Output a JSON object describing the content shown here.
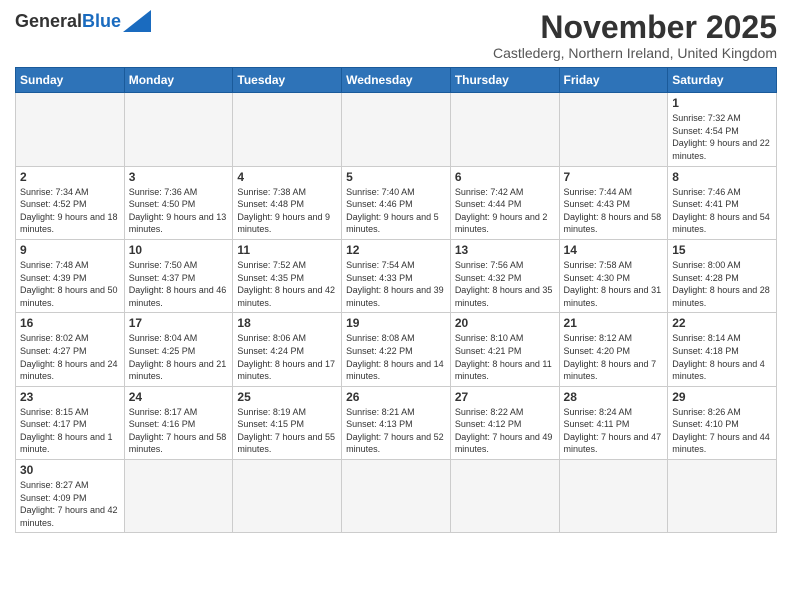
{
  "header": {
    "logo_general": "General",
    "logo_blue": "Blue",
    "title": "November 2025",
    "subtitle": "Castlederg, Northern Ireland, United Kingdom"
  },
  "calendar": {
    "days_of_week": [
      "Sunday",
      "Monday",
      "Tuesday",
      "Wednesday",
      "Thursday",
      "Friday",
      "Saturday"
    ],
    "weeks": [
      [
        {
          "day": null,
          "info": ""
        },
        {
          "day": null,
          "info": ""
        },
        {
          "day": null,
          "info": ""
        },
        {
          "day": null,
          "info": ""
        },
        {
          "day": null,
          "info": ""
        },
        {
          "day": null,
          "info": ""
        },
        {
          "day": "1",
          "info": "Sunrise: 7:32 AM\nSunset: 4:54 PM\nDaylight: 9 hours and 22 minutes."
        }
      ],
      [
        {
          "day": "2",
          "info": "Sunrise: 7:34 AM\nSunset: 4:52 PM\nDaylight: 9 hours and 18 minutes."
        },
        {
          "day": "3",
          "info": "Sunrise: 7:36 AM\nSunset: 4:50 PM\nDaylight: 9 hours and 13 minutes."
        },
        {
          "day": "4",
          "info": "Sunrise: 7:38 AM\nSunset: 4:48 PM\nDaylight: 9 hours and 9 minutes."
        },
        {
          "day": "5",
          "info": "Sunrise: 7:40 AM\nSunset: 4:46 PM\nDaylight: 9 hours and 5 minutes."
        },
        {
          "day": "6",
          "info": "Sunrise: 7:42 AM\nSunset: 4:44 PM\nDaylight: 9 hours and 2 minutes."
        },
        {
          "day": "7",
          "info": "Sunrise: 7:44 AM\nSunset: 4:43 PM\nDaylight: 8 hours and 58 minutes."
        },
        {
          "day": "8",
          "info": "Sunrise: 7:46 AM\nSunset: 4:41 PM\nDaylight: 8 hours and 54 minutes."
        }
      ],
      [
        {
          "day": "9",
          "info": "Sunrise: 7:48 AM\nSunset: 4:39 PM\nDaylight: 8 hours and 50 minutes."
        },
        {
          "day": "10",
          "info": "Sunrise: 7:50 AM\nSunset: 4:37 PM\nDaylight: 8 hours and 46 minutes."
        },
        {
          "day": "11",
          "info": "Sunrise: 7:52 AM\nSunset: 4:35 PM\nDaylight: 8 hours and 42 minutes."
        },
        {
          "day": "12",
          "info": "Sunrise: 7:54 AM\nSunset: 4:33 PM\nDaylight: 8 hours and 39 minutes."
        },
        {
          "day": "13",
          "info": "Sunrise: 7:56 AM\nSunset: 4:32 PM\nDaylight: 8 hours and 35 minutes."
        },
        {
          "day": "14",
          "info": "Sunrise: 7:58 AM\nSunset: 4:30 PM\nDaylight: 8 hours and 31 minutes."
        },
        {
          "day": "15",
          "info": "Sunrise: 8:00 AM\nSunset: 4:28 PM\nDaylight: 8 hours and 28 minutes."
        }
      ],
      [
        {
          "day": "16",
          "info": "Sunrise: 8:02 AM\nSunset: 4:27 PM\nDaylight: 8 hours and 24 minutes."
        },
        {
          "day": "17",
          "info": "Sunrise: 8:04 AM\nSunset: 4:25 PM\nDaylight: 8 hours and 21 minutes."
        },
        {
          "day": "18",
          "info": "Sunrise: 8:06 AM\nSunset: 4:24 PM\nDaylight: 8 hours and 17 minutes."
        },
        {
          "day": "19",
          "info": "Sunrise: 8:08 AM\nSunset: 4:22 PM\nDaylight: 8 hours and 14 minutes."
        },
        {
          "day": "20",
          "info": "Sunrise: 8:10 AM\nSunset: 4:21 PM\nDaylight: 8 hours and 11 minutes."
        },
        {
          "day": "21",
          "info": "Sunrise: 8:12 AM\nSunset: 4:20 PM\nDaylight: 8 hours and 7 minutes."
        },
        {
          "day": "22",
          "info": "Sunrise: 8:14 AM\nSunset: 4:18 PM\nDaylight: 8 hours and 4 minutes."
        }
      ],
      [
        {
          "day": "23",
          "info": "Sunrise: 8:15 AM\nSunset: 4:17 PM\nDaylight: 8 hours and 1 minute."
        },
        {
          "day": "24",
          "info": "Sunrise: 8:17 AM\nSunset: 4:16 PM\nDaylight: 7 hours and 58 minutes."
        },
        {
          "day": "25",
          "info": "Sunrise: 8:19 AM\nSunset: 4:15 PM\nDaylight: 7 hours and 55 minutes."
        },
        {
          "day": "26",
          "info": "Sunrise: 8:21 AM\nSunset: 4:13 PM\nDaylight: 7 hours and 52 minutes."
        },
        {
          "day": "27",
          "info": "Sunrise: 8:22 AM\nSunset: 4:12 PM\nDaylight: 7 hours and 49 minutes."
        },
        {
          "day": "28",
          "info": "Sunrise: 8:24 AM\nSunset: 4:11 PM\nDaylight: 7 hours and 47 minutes."
        },
        {
          "day": "29",
          "info": "Sunrise: 8:26 AM\nSunset: 4:10 PM\nDaylight: 7 hours and 44 minutes."
        }
      ],
      [
        {
          "day": "30",
          "info": "Sunrise: 8:27 AM\nSunset: 4:09 PM\nDaylight: 7 hours and 42 minutes."
        },
        {
          "day": null,
          "info": ""
        },
        {
          "day": null,
          "info": ""
        },
        {
          "day": null,
          "info": ""
        },
        {
          "day": null,
          "info": ""
        },
        {
          "day": null,
          "info": ""
        },
        {
          "day": null,
          "info": ""
        }
      ]
    ]
  }
}
